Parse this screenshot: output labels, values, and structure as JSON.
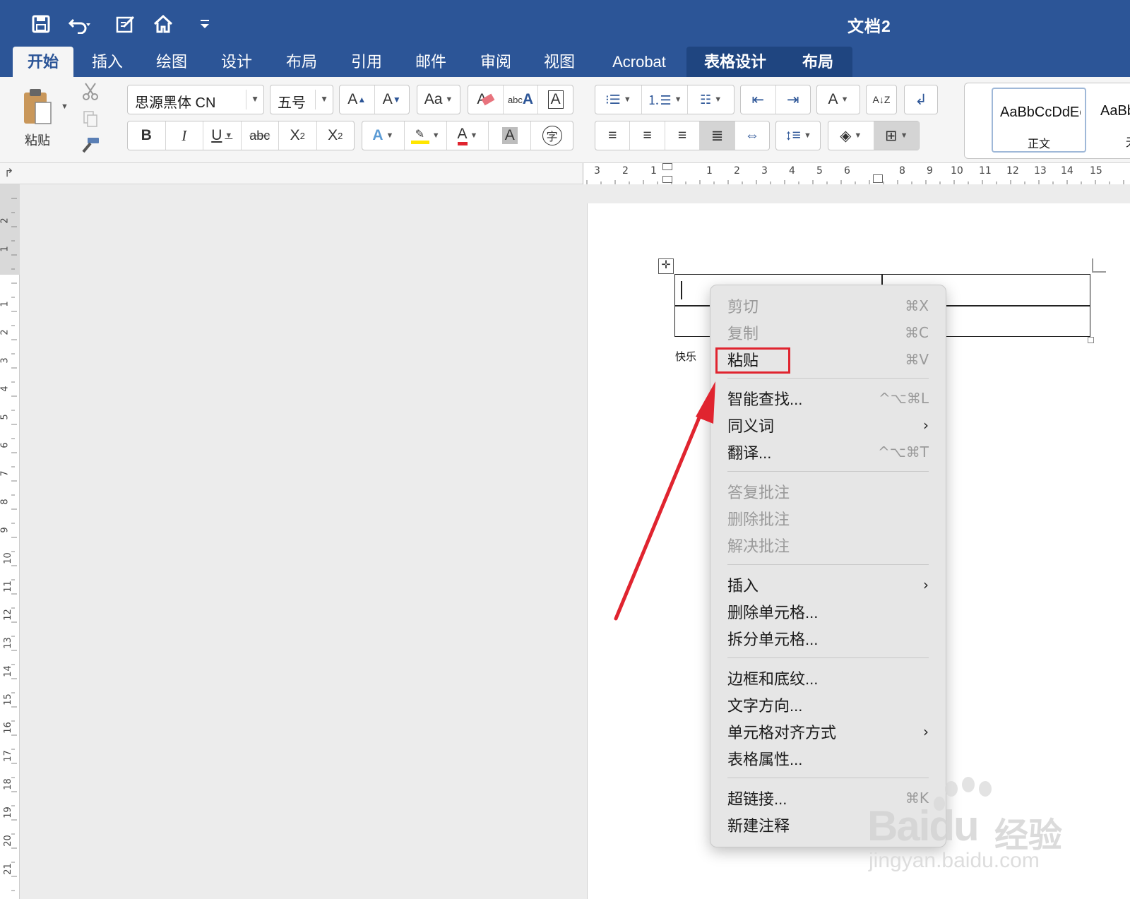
{
  "window": {
    "title": "文档2"
  },
  "quick_access": [
    {
      "name": "save-icon",
      "glyph": "💾"
    },
    {
      "name": "undo-icon",
      "glyph": "↶"
    },
    {
      "name": "edit-doc-icon",
      "glyph": "✎"
    },
    {
      "name": "home-icon",
      "glyph": "⌂"
    },
    {
      "name": "customize-icon",
      "glyph": "⌄"
    }
  ],
  "tabs": [
    "开始",
    "插入",
    "绘图",
    "设计",
    "布局",
    "引用",
    "邮件",
    "审阅",
    "视图",
    "Acrobat",
    "表格设计",
    "布局"
  ],
  "ribbon": {
    "paste_label": "粘贴",
    "font_name": "思源黑体 CN",
    "font_size": "五号",
    "style_normal_preview": "AaBbCcDdEe",
    "style_normal_label": "正文",
    "style_nospacing_preview": "AaBb",
    "style_nospacing_label": "无"
  },
  "ruler": {
    "h_left_numbers": [
      "3",
      "2",
      "1"
    ],
    "h_right_numbers": [
      "1",
      "2",
      "3",
      "4",
      "5",
      "6",
      "8",
      "9",
      "10",
      "11",
      "12",
      "13",
      "14",
      "15"
    ],
    "v_numbers": [
      "2",
      "1",
      "1",
      "2",
      "3",
      "4",
      "5",
      "6",
      "7",
      "8",
      "9",
      "10",
      "11",
      "12",
      "13",
      "14",
      "15",
      "16",
      "17",
      "18",
      "19",
      "20",
      "21"
    ]
  },
  "document": {
    "below_table_text": "快乐"
  },
  "context_menu": {
    "cut": {
      "label": "剪切",
      "shortcut": "⌘X"
    },
    "copy": {
      "label": "复制",
      "shortcut": "⌘C"
    },
    "paste": {
      "label": "粘贴",
      "shortcut": "⌘V"
    },
    "smart_lookup": {
      "label": "智能查找...",
      "shortcut": "^⌥⌘L"
    },
    "synonyms": {
      "label": "同义词"
    },
    "translate": {
      "label": "翻译...",
      "shortcut": "^⌥⌘T"
    },
    "reply_comment": {
      "label": "答复批注"
    },
    "delete_comment": {
      "label": "删除批注"
    },
    "resolve_comment": {
      "label": "解决批注"
    },
    "insert": {
      "label": "插入"
    },
    "delete_cells": {
      "label": "删除单元格..."
    },
    "split_cells": {
      "label": "拆分单元格..."
    },
    "borders_shading": {
      "label": "边框和底纹..."
    },
    "text_direction": {
      "label": "文字方向..."
    },
    "cell_alignment": {
      "label": "单元格对齐方式"
    },
    "table_properties": {
      "label": "表格属性..."
    },
    "hyperlink": {
      "label": "超链接...",
      "shortcut": "⌘K"
    },
    "new_comment": {
      "label": "新建注释"
    }
  },
  "watermark": {
    "logo": "Baidu",
    "brand": "经验",
    "url": "jingyan.baidu.com"
  },
  "colors": {
    "titlebar": "#2c5597",
    "highlight_red": "#e0242f",
    "menu_bg": "#e6e6e6"
  }
}
